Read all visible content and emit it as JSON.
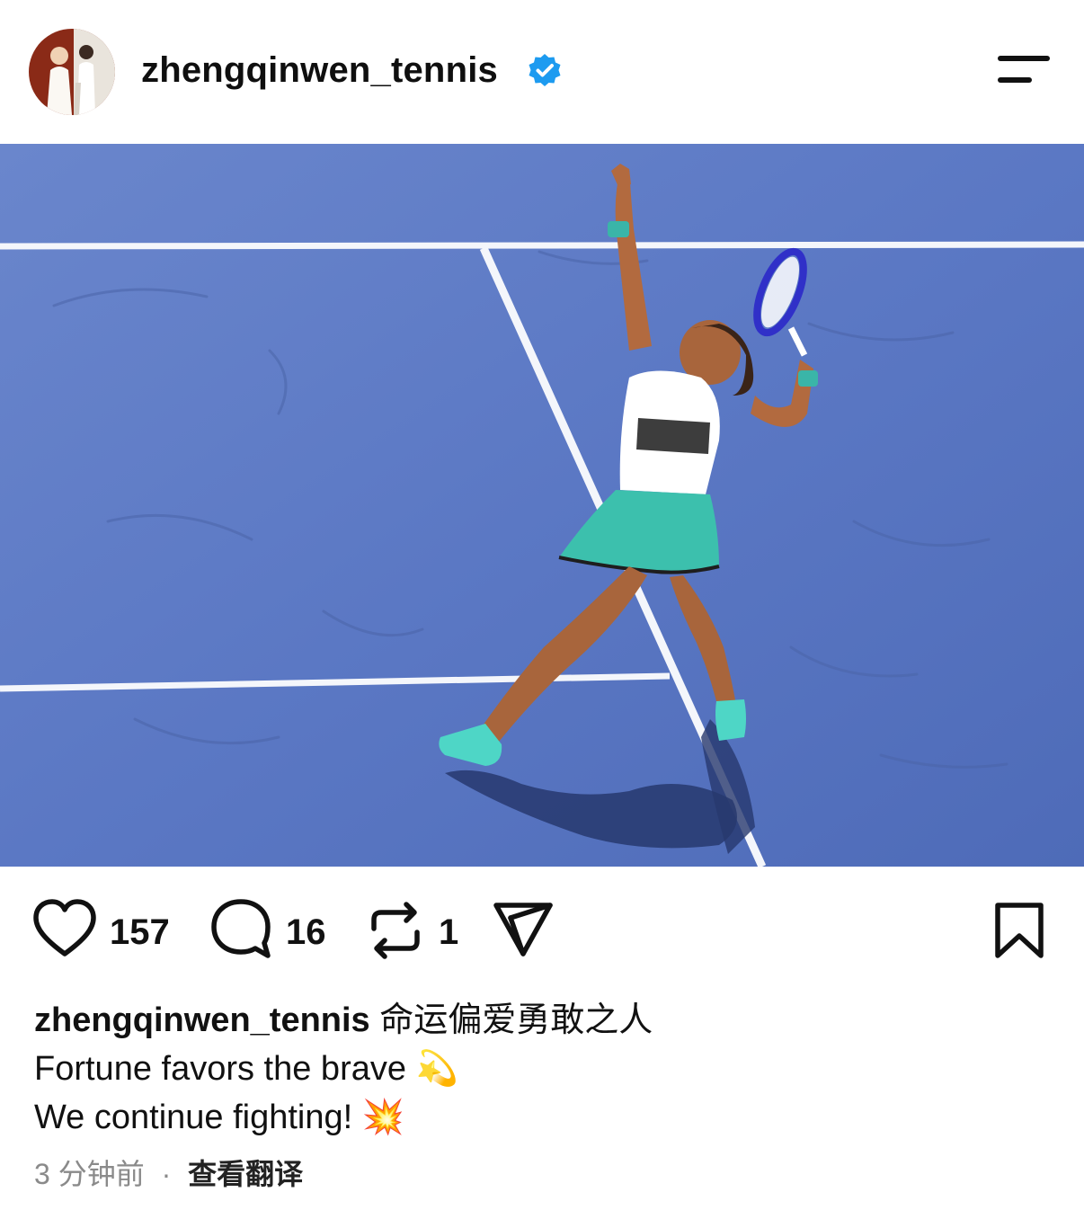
{
  "header": {
    "username": "zhengqinwen_tennis",
    "verified_icon": "verified-badge-icon",
    "menu_icon": "menu-icon"
  },
  "post": {
    "image_description_icon": "post-photo"
  },
  "actions": {
    "likes": "157",
    "comments": "16",
    "reposts": "1",
    "like_icon": "heart-icon",
    "comment_icon": "comment-bubble-icon",
    "repost_icon": "repost-icon",
    "share_icon": "send-icon",
    "save_icon": "bookmark-icon"
  },
  "caption": {
    "username": "zhengqinwen_tennis",
    "line1_text": "命运偏爱勇敢之人",
    "line2_text": "Fortune favors the brave",
    "line2_emoji": "💫",
    "line3_text": "We continue fighting!",
    "line3_emoji": "💥"
  },
  "meta": {
    "time": "3 分钟前",
    "separator": "·",
    "translate": "查看翻译"
  },
  "colors": {
    "verified": "#1d9bf0",
    "court": "#5b78c4",
    "court_line": "#f4f6fb",
    "meta_text": "#8a8a8a"
  }
}
